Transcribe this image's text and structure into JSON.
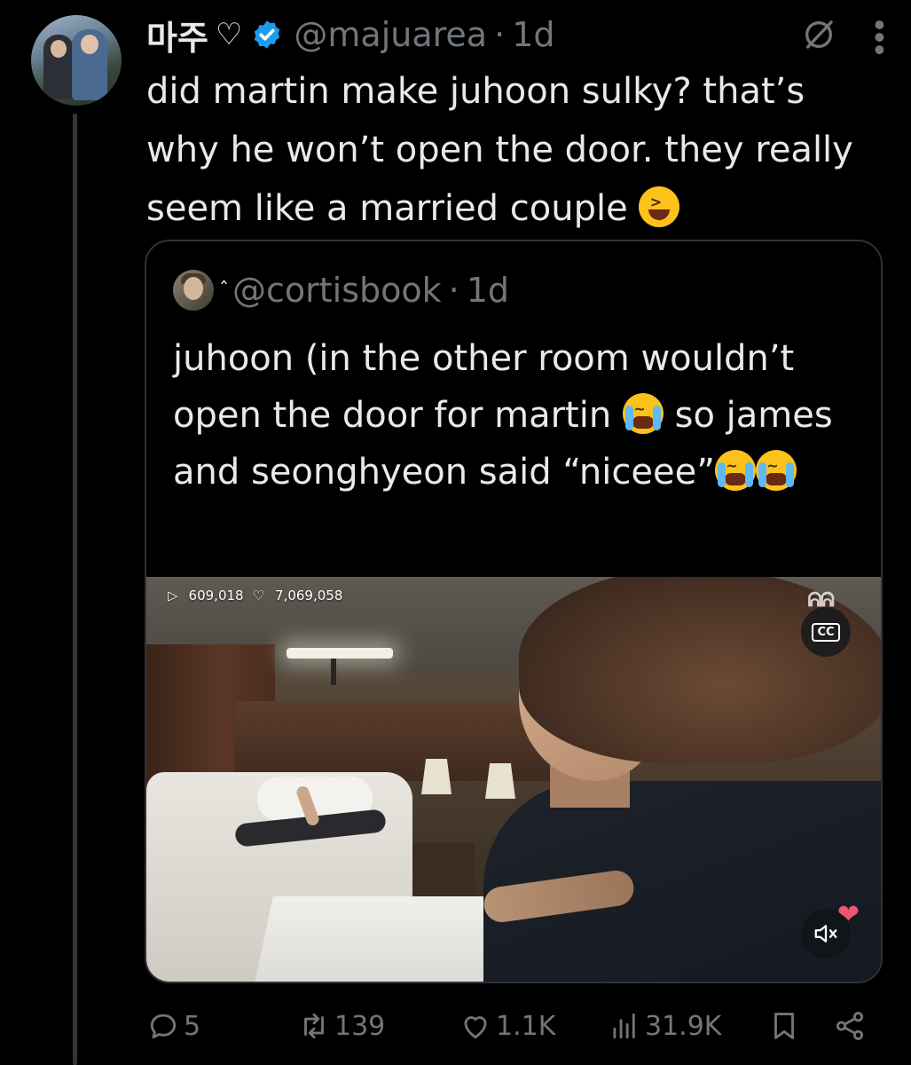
{
  "tweet": {
    "display_name": "마주",
    "name_heart": "♡",
    "handle": "@majuarea",
    "separator": "·",
    "time": "1d",
    "text_main": "did martin make juhoon sulky? that’s why he won’t open the door. they really seem like a married couple ",
    "text_emoji": "laughing-squinting-face-emoji"
  },
  "quote": {
    "handle": "@cortisbook",
    "separator": "·",
    "time": "1d",
    "name_mark": "ˆ",
    "line1": "juhoon (in the other room wouldn’t open the door for martin ",
    "line2": " so james and seonghyeon said “niceee”",
    "emoji": "loudly-crying-face-emoji"
  },
  "video": {
    "views": "609,018",
    "likes": "7,069,058",
    "watermark": "ᕱᕱ",
    "cc_label": "CC",
    "mute_icon": "muted-speaker-icon"
  },
  "actions": {
    "replies": "5",
    "reposts": "139",
    "likes": "1.1K",
    "views": "31.9K"
  },
  "colors": {
    "background": "#000000",
    "text": "#e7e9ea",
    "muted": "#71767b",
    "verified": "#1d9bf0",
    "border": "#2f3336"
  }
}
